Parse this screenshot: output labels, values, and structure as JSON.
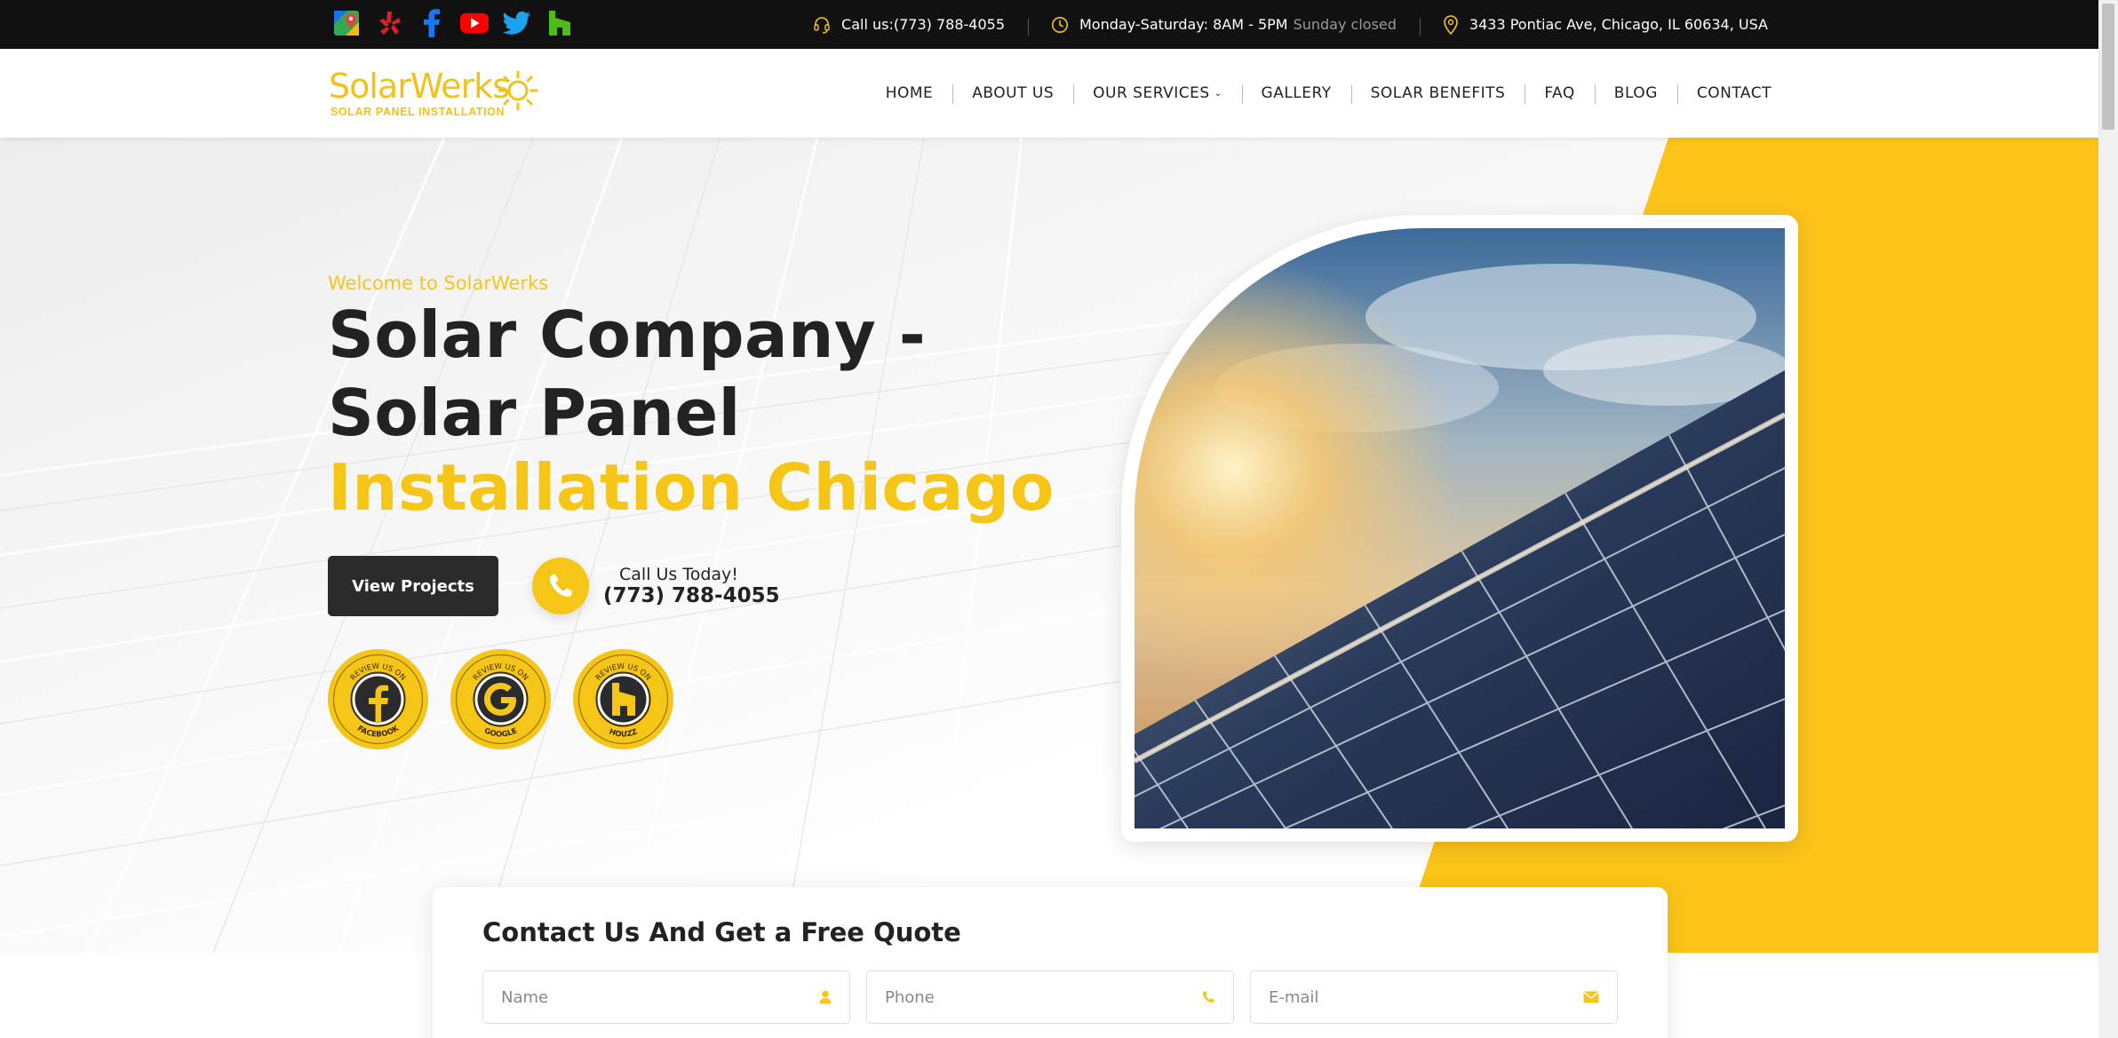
{
  "colors": {
    "accent": "#f5c518",
    "topbar_bg": "#111111",
    "dark_button": "#2b2b2b"
  },
  "topbar": {
    "social_icons": [
      "google-maps-icon",
      "yelp-icon",
      "facebook-icon",
      "youtube-icon",
      "twitter-icon",
      "houzz-icon"
    ],
    "call": "Call us:(773) 788-4055",
    "hours": "Monday-Saturday: 8AM - 5PM",
    "hours_closed": "Sunday closed",
    "address": "3433 Pontiac Ave, Chicago, IL 60634, USA"
  },
  "header": {
    "logo_word": "SolarWerks",
    "logo_sub": "SOLAR PANEL INSTALLATION",
    "nav": [
      "HOME",
      "ABOUT US",
      "OUR SERVICES",
      "GALLERY",
      "SOLAR BENEFITS",
      "FAQ",
      "BLOG",
      "CONTACT"
    ]
  },
  "hero": {
    "welcome": "Welcome to SolarWerks",
    "title_line1": "Solar Company -",
    "title_line2": "Solar Panel",
    "title_line3": "Installation Chicago",
    "view_projects": "View Projects",
    "call_label": "Call Us Today!",
    "call_number": "(773) 788-4055",
    "badges": [
      {
        "top": "REVIEW US ON",
        "bottom": "FACEBOOK",
        "icon": "facebook-icon"
      },
      {
        "top": "REVIEW US ON",
        "bottom": "GOOGLE",
        "icon": "google-icon"
      },
      {
        "top": "REVIEW US ON",
        "bottom": "HOUZZ",
        "icon": "houzz-icon"
      }
    ]
  },
  "form": {
    "title": "Contact Us And Get a Free Quote",
    "name_placeholder": "Name",
    "phone_placeholder": "Phone",
    "email_placeholder": "E-mail"
  }
}
